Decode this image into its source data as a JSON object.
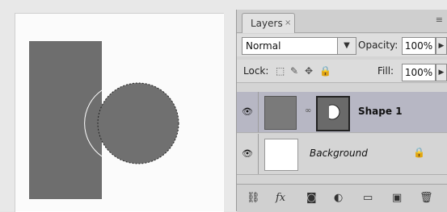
{
  "panel": {
    "tab_label": "Layers",
    "tab_close": "×",
    "menu_glyph": "≡",
    "blend_mode": "Normal",
    "opacity_label": "Opacity:",
    "opacity_value": "100%",
    "lock_label": "Lock:",
    "fill_label": "Fill:",
    "fill_value": "100%"
  },
  "layers": [
    {
      "name": "Shape 1",
      "visible": true,
      "selected": true
    },
    {
      "name": "Background",
      "visible": true,
      "locked": true
    }
  ],
  "icons": {
    "eye": "👁",
    "link": "∞",
    "lock": "🔒",
    "arrow_down": "▼",
    "arrow_right": "▶",
    "bottom": [
      "link-layers-icon",
      "fx-icon",
      "add-mask-icon",
      "adjustment-layer-icon",
      "new-group-icon",
      "new-layer-icon",
      "delete-layer-icon"
    ],
    "bottom_glyphs": [
      "⛓",
      "fx",
      "◙",
      "◐",
      "▭",
      "▣",
      "🗑"
    ]
  },
  "colors": {
    "selected_layer": "#b7b7c4",
    "panel_bg": "#d4d4d4",
    "shape_fill": "#6e6e6e"
  }
}
